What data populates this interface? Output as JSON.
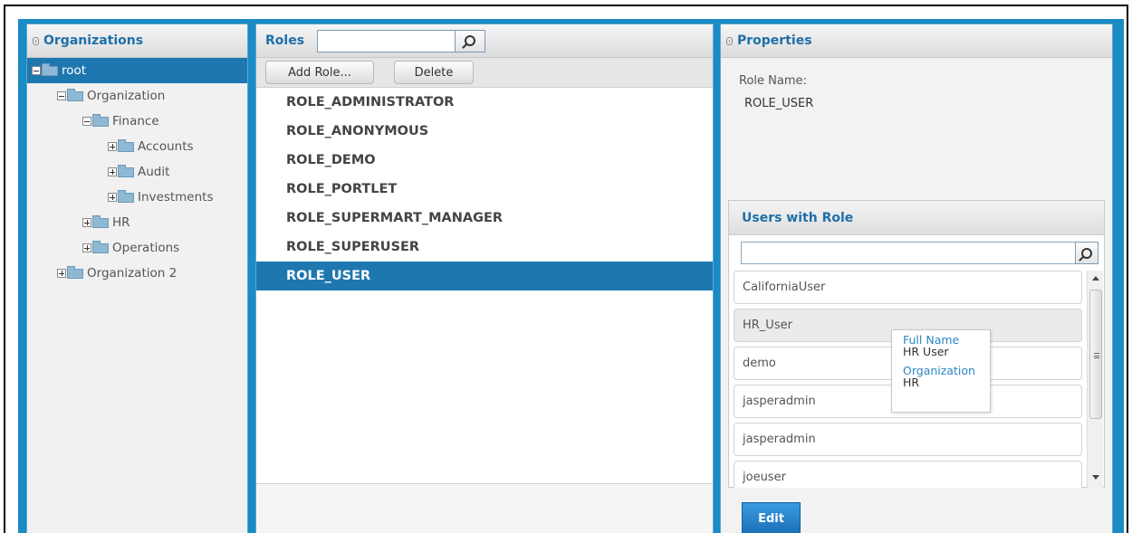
{
  "organizations": {
    "title": "Organizations",
    "tree": [
      {
        "label": "root",
        "level": 0,
        "expanded": true,
        "selected": true
      },
      {
        "label": "Organization",
        "level": 1,
        "expanded": true
      },
      {
        "label": "Finance",
        "level": 2,
        "expanded": true
      },
      {
        "label": "Accounts",
        "level": 3,
        "expanded": false
      },
      {
        "label": "Audit",
        "level": 3,
        "expanded": false
      },
      {
        "label": "Investments",
        "level": 3,
        "expanded": false
      },
      {
        "label": "HR",
        "level": 2,
        "expanded": false
      },
      {
        "label": "Operations",
        "level": 2,
        "expanded": false
      },
      {
        "label": "Organization 2",
        "level": 1,
        "expanded": false
      }
    ]
  },
  "roles": {
    "title": "Roles",
    "search_value": "",
    "add_label": "Add Role...",
    "delete_label": "Delete",
    "items": [
      {
        "label": "ROLE_ADMINISTRATOR"
      },
      {
        "label": "ROLE_ANONYMOUS"
      },
      {
        "label": "ROLE_DEMO"
      },
      {
        "label": "ROLE_PORTLET"
      },
      {
        "label": "ROLE_SUPERMART_MANAGER"
      },
      {
        "label": "ROLE_SUPERUSER"
      },
      {
        "label": "ROLE_USER",
        "selected": true
      }
    ]
  },
  "properties": {
    "title": "Properties",
    "role_name_label": "Role Name:",
    "role_name_value": "ROLE_USER",
    "users_with_role": {
      "title": "Users with Role",
      "search_value": "",
      "users": [
        "CaliforniaUser",
        "HR_User",
        "demo",
        "jasperadmin",
        "jasperadmin",
        "joeuser"
      ],
      "hover_index": 1
    },
    "tooltip": {
      "full_name_label": "Full Name",
      "full_name_value": "HR User",
      "organization_label": "Organization",
      "organization_value": "HR"
    },
    "edit_label": "Edit"
  },
  "colors": {
    "accent": "#1a8bc4",
    "selected": "#1f77b0",
    "header_text": "#1f6fa8"
  }
}
